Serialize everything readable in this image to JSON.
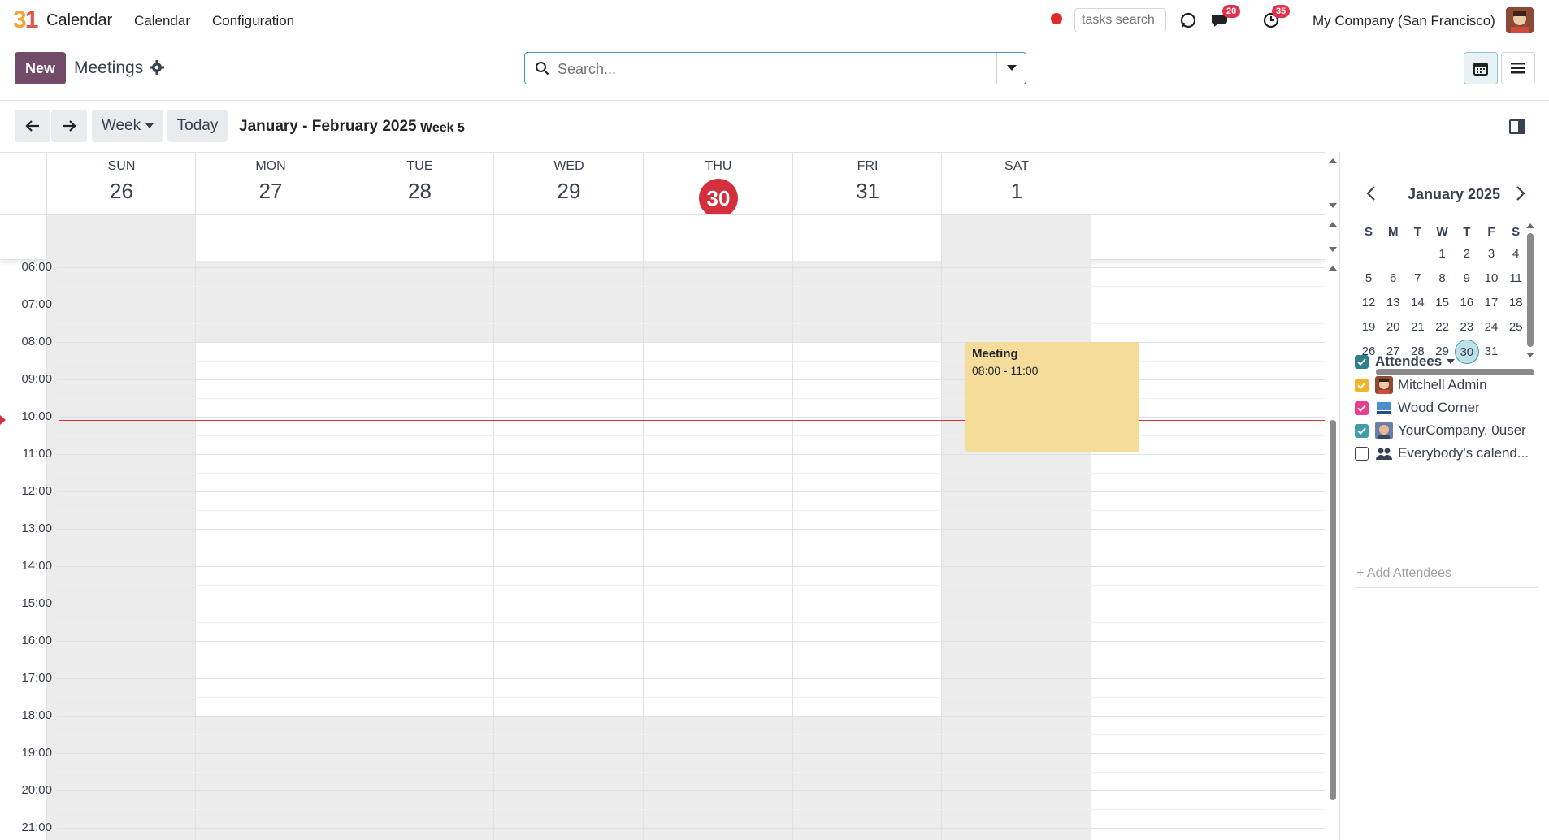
{
  "topbar": {
    "app_name": "Calendar",
    "menu": [
      "Calendar",
      "Configuration"
    ],
    "tasks_search_placeholder": "tasks search",
    "messages_badge": "20",
    "activities_badge": "35",
    "company": "My Company (San Francisco)"
  },
  "control_panel": {
    "new_label": "New",
    "title": "Meetings",
    "search_placeholder": "Search..."
  },
  "nav": {
    "scale_label": "Week",
    "today_label": "Today",
    "period": "January - February 2025",
    "week": "Week 5"
  },
  "week_days": [
    {
      "name": "SUN",
      "num": "26"
    },
    {
      "name": "MON",
      "num": "27"
    },
    {
      "name": "TUE",
      "num": "28"
    },
    {
      "name": "WED",
      "num": "29"
    },
    {
      "name": "THU",
      "num": "30"
    },
    {
      "name": "FRI",
      "num": "31"
    },
    {
      "name": "SAT",
      "num": "1"
    }
  ],
  "hours": [
    "06:00",
    "07:00",
    "08:00",
    "09:00",
    "10:00",
    "11:00",
    "12:00",
    "13:00",
    "14:00",
    "15:00",
    "16:00",
    "17:00",
    "18:00",
    "19:00",
    "20:00",
    "21:00"
  ],
  "event": {
    "title": "Meeting",
    "time": "08:00 - 11:00"
  },
  "mini_calendar": {
    "title": "January 2025",
    "weekdays": [
      "S",
      "M",
      "T",
      "W",
      "T",
      "F",
      "S"
    ],
    "weeks": [
      [
        "",
        "",
        "",
        "1",
        "2",
        "3",
        "4"
      ],
      [
        "5",
        "6",
        "7",
        "8",
        "9",
        "10",
        "11"
      ],
      [
        "12",
        "13",
        "14",
        "15",
        "16",
        "17",
        "18"
      ],
      [
        "19",
        "20",
        "21",
        "22",
        "23",
        "24",
        "25"
      ],
      [
        "26",
        "27",
        "28",
        "29",
        "30",
        "31",
        ""
      ]
    ],
    "selected": "30"
  },
  "attendees": {
    "header": "Attendees",
    "items": [
      {
        "name": "Mitchell Admin",
        "checked": true,
        "color": "#f0b429"
      },
      {
        "name": "Wood Corner",
        "checked": true,
        "color": "#e83e8c"
      },
      {
        "name": "YourCompany, 0user",
        "checked": true,
        "color": "#3f9ca8"
      },
      {
        "name": "Everybody's calend...",
        "checked": false,
        "color": "#ffffff"
      }
    ],
    "add_label": "+ Add Attendees"
  },
  "colors": {
    "brand": "#714b67",
    "today": "#d32f3c",
    "event_bg": "#f5dc9a",
    "accent": "#3f9ca8"
  }
}
